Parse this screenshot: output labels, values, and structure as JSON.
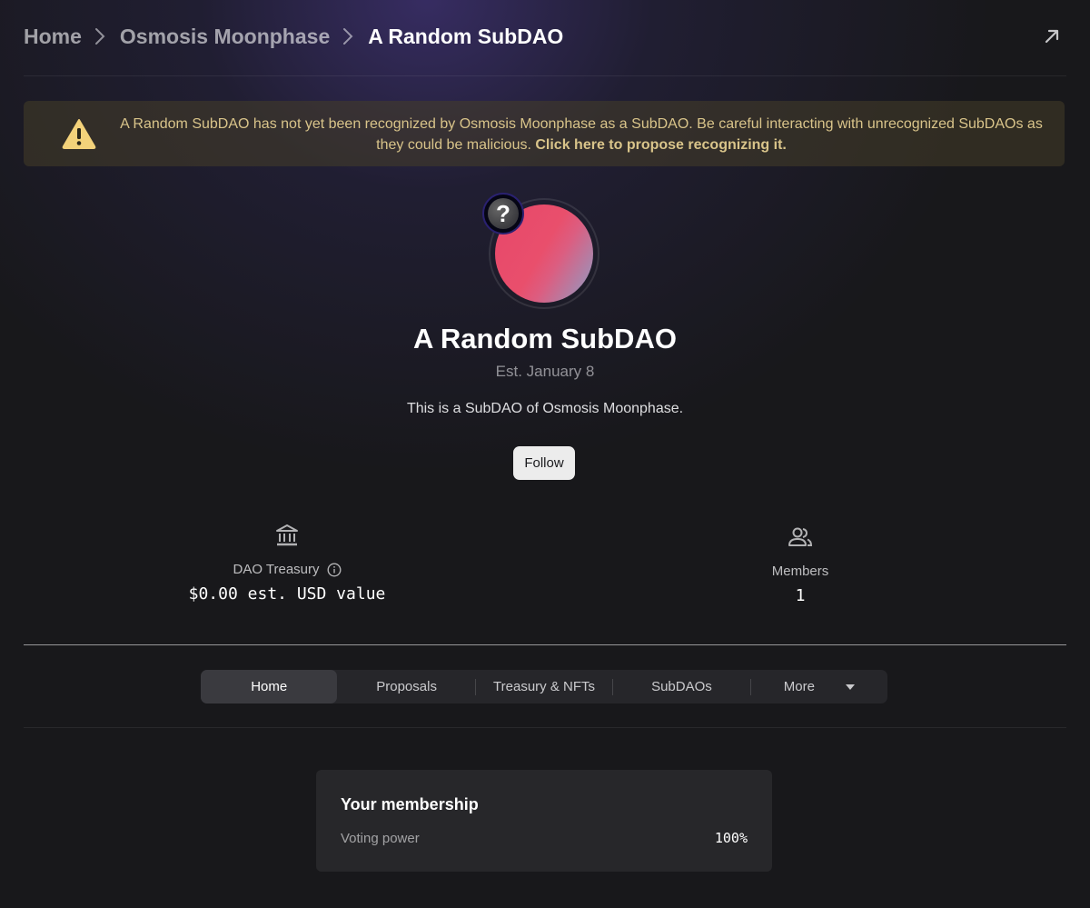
{
  "breadcrumb": {
    "items": [
      "Home",
      "Osmosis Moonphase"
    ],
    "current": "A Random SubDAO"
  },
  "icons": {
    "share": "arrow-up-right-icon",
    "warning": "warning-triangle-icon",
    "treasury": "bank-icon",
    "members": "people-icon",
    "info": "info-icon",
    "chevron": "chevron-right-icon",
    "dropdown": "caret-down-icon"
  },
  "warning": {
    "text": "A Random SubDAO has not yet been recognized by Osmosis Moonphase as a SubDAO. Be careful interacting with unrecognized SubDAOs as they could be malicious. ",
    "link": "Click here to propose recognizing it."
  },
  "dao": {
    "badge": "?",
    "title": "A Random SubDAO",
    "established": "Est. January 8",
    "description": "This is a SubDAO of Osmosis Moonphase.",
    "follow_label": "Follow"
  },
  "stats": {
    "treasury_label": "DAO Treasury",
    "treasury_value": "$0.00 est. USD value",
    "members_label": "Members",
    "members_value": "1"
  },
  "tabs": [
    {
      "label": "Home",
      "active": true
    },
    {
      "label": "Proposals",
      "active": false
    },
    {
      "label": "Treasury & NFTs",
      "active": false
    },
    {
      "label": "SubDAOs",
      "active": false
    },
    {
      "label": "More",
      "active": false
    }
  ],
  "membership": {
    "title": "Your membership",
    "voting_power_label": "Voting power",
    "voting_power_value": "100%"
  },
  "colors": {
    "background": "#18181b",
    "warning_bg": "#3b3627",
    "warning_text": "#d9c48a",
    "warning_icon": "#f3d27a",
    "avatar_start": "#e7476a",
    "avatar_end": "#8aa0c8"
  }
}
